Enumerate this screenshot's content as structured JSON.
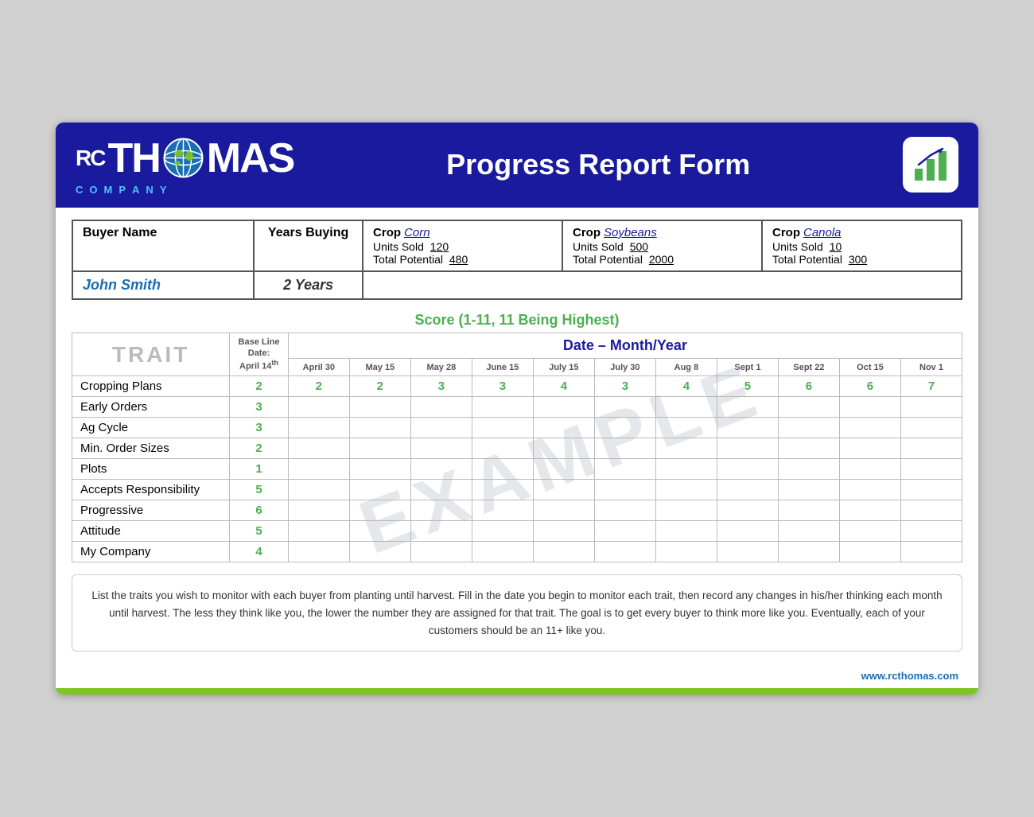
{
  "header": {
    "title": "Progress Report Form",
    "logo_letters": [
      "R",
      "C",
      "T",
      "H",
      "O",
      "M",
      "A",
      "S"
    ],
    "company_letters": [
      "C",
      "O",
      "M",
      "P",
      "A",
      "N",
      "Y"
    ],
    "website": "www.rcthomas.com"
  },
  "buyer": {
    "name_label": "Buyer Name",
    "years_label": "Years Buying",
    "name_value": "John Smith",
    "years_value": "2 Years"
  },
  "crops": [
    {
      "label": "Crop",
      "name": "Corn",
      "units_sold_label": "Units Sold",
      "units_sold_value": "120",
      "total_potential_label": "Total Potential",
      "total_potential_value": "480"
    },
    {
      "label": "Crop",
      "name": "Soybeans",
      "units_sold_label": "Units Sold",
      "units_sold_value": "500",
      "total_potential_label": "Total Potential",
      "total_potential_value": "2000"
    },
    {
      "label": "Crop",
      "name": "Canola",
      "units_sold_label": "Units Sold",
      "units_sold_value": "10",
      "total_potential_label": "Total Potential",
      "total_potential_value": "300"
    }
  ],
  "score_title": "Score (1-11, 11 Being Highest)",
  "table": {
    "trait_header": "TRAIT",
    "baseline_header_line1": "Base Line",
    "baseline_header_line2": "Date:",
    "baseline_date": "April 14th",
    "date_header": "Date – Month/Year",
    "date_columns": [
      "April 30",
      "May 15",
      "May 28",
      "June 15",
      "July 15",
      "July 30",
      "Aug 8",
      "Sept 1",
      "Sept 22",
      "Oct 15",
      "Nov 1"
    ],
    "traits": [
      {
        "name": "Cropping Plans",
        "baseline": "2",
        "scores": [
          "2",
          "2",
          "3",
          "3",
          "4",
          "3",
          "4",
          "5",
          "6",
          "6",
          "7"
        ]
      },
      {
        "name": "Early Orders",
        "baseline": "3",
        "scores": [
          "",
          "",
          "",
          "",
          "",
          "",
          "",
          "",
          "",
          "",
          ""
        ]
      },
      {
        "name": "Ag Cycle",
        "baseline": "3",
        "scores": [
          "",
          "",
          "",
          "",
          "",
          "",
          "",
          "",
          "",
          "",
          ""
        ]
      },
      {
        "name": "Min. Order Sizes",
        "baseline": "2",
        "scores": [
          "",
          "",
          "",
          "",
          "",
          "",
          "",
          "",
          "",
          "",
          ""
        ]
      },
      {
        "name": "Plots",
        "baseline": "1",
        "scores": [
          "",
          "",
          "",
          "",
          "",
          "",
          "",
          "",
          "",
          "",
          ""
        ]
      },
      {
        "name": "Accepts Responsibility",
        "baseline": "5",
        "scores": [
          "",
          "",
          "",
          "",
          "",
          "",
          "",
          "",
          "",
          "",
          ""
        ]
      },
      {
        "name": "Progressive",
        "baseline": "6",
        "scores": [
          "",
          "",
          "",
          "",
          "",
          "",
          "",
          "",
          "",
          "",
          ""
        ]
      },
      {
        "name": "Attitude",
        "baseline": "5",
        "scores": [
          "",
          "",
          "",
          "",
          "",
          "",
          "",
          "",
          "",
          "",
          ""
        ]
      },
      {
        "name": "My Company",
        "baseline": "4",
        "scores": [
          "",
          "",
          "",
          "",
          "",
          "",
          "",
          "",
          "",
          "",
          ""
        ]
      }
    ]
  },
  "example_text": "EXAMPLE",
  "instructions": "List the traits you wish to monitor with each buyer from planting until harvest.  Fill in the date you begin to monitor each trait, then record any changes in his/her thinking each month until harvest.  The less they think like you, the lower the number they are assigned for that trait.  The goal is to get every buyer to think more like you.  Eventually, each of your customers should be an 11+ like you."
}
